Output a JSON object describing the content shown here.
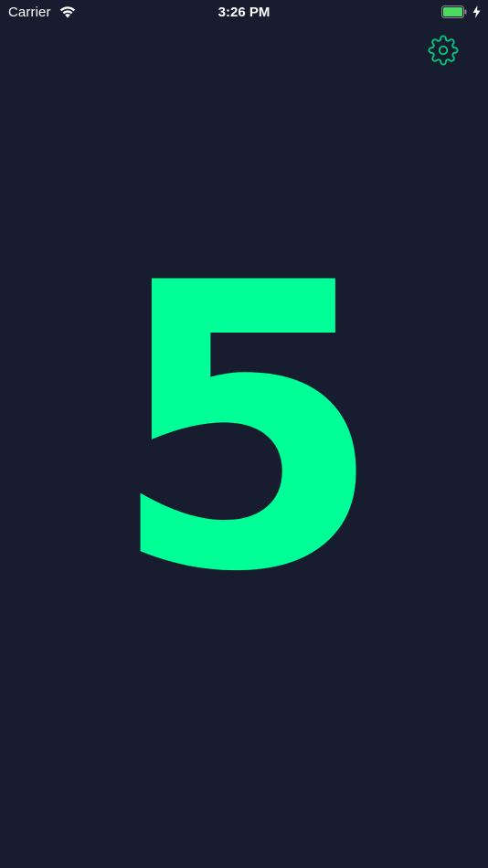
{
  "status_bar": {
    "carrier": "Carrier",
    "time": "3:26 PM",
    "wifi_icon": "wifi-icon",
    "battery_icon": "battery-charging-icon",
    "battery_color": "#4cd964"
  },
  "settings": {
    "icon": "gear-icon",
    "color": "#00c880"
  },
  "counter": {
    "value": "5",
    "color": "#00ff96"
  },
  "theme": {
    "background": "#171c2e"
  }
}
